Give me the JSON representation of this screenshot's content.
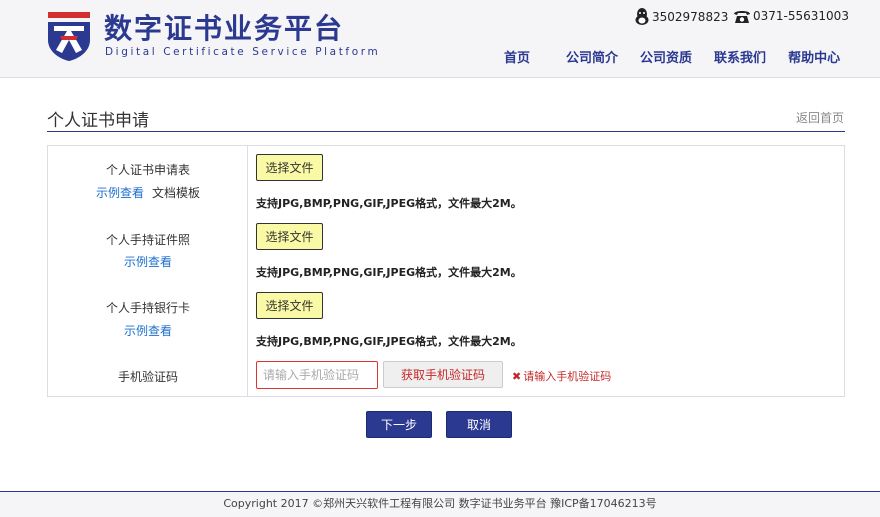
{
  "header": {
    "brand_cn": "数字证书业务平台",
    "brand_en": "Digital Certificate Service Platform",
    "qq_number": "3502978823",
    "phone": "0371-55631003",
    "nav": [
      "首页",
      "公司简介",
      "公司资质",
      "联系我们",
      "帮助中心"
    ]
  },
  "page": {
    "title": "个人证书申请",
    "back_link": "返回首页"
  },
  "form": {
    "rows": [
      {
        "label": "个人证书申请表",
        "example_link": "示例查看",
        "template_link": "文档模板",
        "file_button": "选择文件",
        "hint": "支持JPG,BMP,PNG,GIF,JPEG格式，文件最大2M。"
      },
      {
        "label": "个人手持证件照",
        "example_link": "示例查看",
        "file_button": "选择文件",
        "hint": "支持JPG,BMP,PNG,GIF,JPEG格式，文件最大2M。"
      },
      {
        "label": "个人手持银行卡",
        "example_link": "示例查看",
        "file_button": "选择文件",
        "hint": "支持JPG,BMP,PNG,GIF,JPEG格式，文件最大2M。"
      }
    ],
    "sms": {
      "label": "手机验证码",
      "value": "",
      "placeholder": "请输入手机验证码",
      "get_code_button": "获取手机验证码",
      "error": "请输入手机验证码"
    }
  },
  "actions": {
    "next": "下一步",
    "cancel": "取消"
  },
  "footer": {
    "text": "Copyright 2017 ©郑州天兴软件工程有限公司 数字证书业务平台 豫ICP备17046213号"
  },
  "colors": {
    "brand": "#2b3990",
    "file_button_bg": "#fafaa6",
    "error": "#c62828",
    "link": "#1d6fce"
  },
  "icons": {
    "logo": "shield-logo-icon",
    "qq": "qq-penguin-icon",
    "phone": "telephone-icon",
    "error": "close-icon"
  }
}
